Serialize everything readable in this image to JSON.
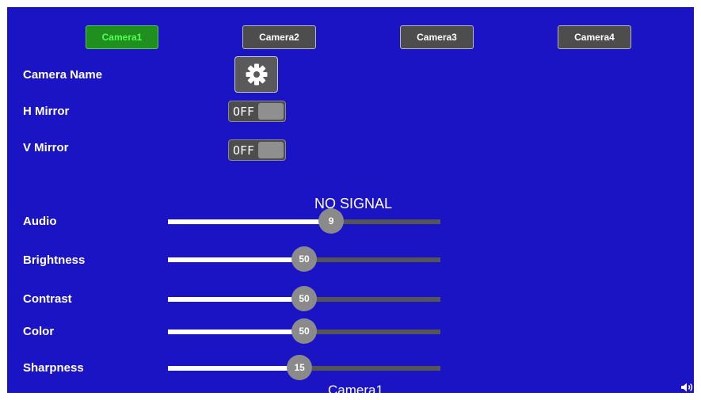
{
  "cameras": [
    {
      "label": "Camera1",
      "active": true
    },
    {
      "label": "Camera2",
      "active": false
    },
    {
      "label": "Camera3",
      "active": false
    },
    {
      "label": "Camera4",
      "active": false
    }
  ],
  "settings": {
    "camera_name_label": "Camera Name",
    "h_mirror_label": "H Mirror",
    "h_mirror_value": "OFF",
    "v_mirror_label": "V Mirror",
    "v_mirror_value": "OFF"
  },
  "status": {
    "no_signal": "NO SIGNAL"
  },
  "sliders": [
    {
      "key": "audio",
      "label": "Audio",
      "value": "9",
      "fill_percent": 59.9
    },
    {
      "key": "brightness",
      "label": "Brightness",
      "value": "50",
      "fill_percent": 50.0
    },
    {
      "key": "contrast",
      "label": "Contrast",
      "value": "50",
      "fill_percent": 50.0
    },
    {
      "key": "color",
      "label": "Color",
      "value": "50",
      "fill_percent": 50.0
    },
    {
      "key": "sharpness",
      "label": "Sharpness",
      "value": "15",
      "fill_percent": 48.3
    }
  ],
  "footer": {
    "current_camera": "Camera1"
  },
  "icons": {
    "settings": "gear-icon",
    "volume": "speaker-icon"
  },
  "colors": {
    "background": "#1a14c4",
    "active_tab": "#1f8f1f",
    "active_text": "#55ff55"
  }
}
